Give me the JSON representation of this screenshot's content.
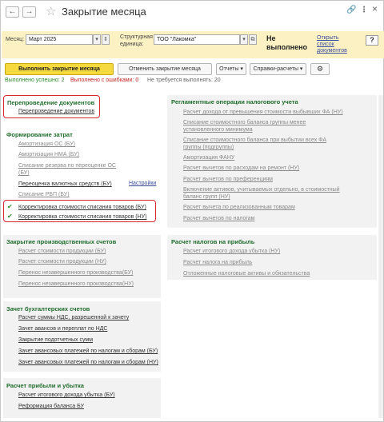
{
  "window": {
    "title": "Закрытие месяца",
    "back_arrow": "←",
    "forward_arrow": "→",
    "star": "☆",
    "link_icon": "🔗",
    "more_icon": "⋮",
    "close_icon": "×"
  },
  "filters": {
    "month_label": "Месяц:",
    "month_value": "Март 2025",
    "unit_label_1": "Структурная",
    "unit_label_2": "единица:",
    "unit_value": "ТОО \"Лакомка\"",
    "status_line1": "Не",
    "status_line2": "выполнено",
    "docs_link_1": "Открыть",
    "docs_link_2": "список",
    "docs_link_3": "документов",
    "help": "?"
  },
  "toolbar": {
    "run": "Выполнить закрытие месяца",
    "cancel": "Отменить закрытие месяца",
    "reports": "Отчеты ▾",
    "references": "Справки-расчеты ▾",
    "gear": "⚙"
  },
  "stats": {
    "success": "Выполнено успешно: 2",
    "errors": "Выполнено с ошибками: 0",
    "not_required": "Не требуется выполнять: 20"
  },
  "sections": {
    "repost": {
      "title": "Перепроведение документов",
      "items": [
        "Перепроведение документов"
      ]
    },
    "costs": {
      "title": "Формирование затрат",
      "items": [
        "Амортизация ОС (БУ)",
        "Амортизация НМА (БУ)",
        "Списание резерва по переоценке ОС (БУ)",
        "Переоценка валютных средств (БУ)",
        "Списание РБП (БУ)",
        "Корректировка стоимости списания товаров (БУ)",
        "Корректировка стоимости списания товаров (НУ)"
      ],
      "settings": "Настройки"
    },
    "tax_ops": {
      "title": "Регламентные операции налогового учета",
      "items": [
        "Расчет дохода от превышения стоимости выбывших ФА (НУ)",
        "Списание стоимостного баланса группы менее установленного минимума",
        "Списание стоимостного баланса при выбытии всех ФА группы (подгруппы)",
        "Амортизация ФАНУ",
        "Расчет вычетов по расходам на ремонт (НУ)",
        "Расчет вычетов по преференциям",
        "Включение активов, учитываемых отдельно, в стоимостный баланс групп (НУ)",
        "Расчет вычета по реализованным товарам",
        "Расчет вычетов по налогам"
      ]
    },
    "production": {
      "title": "Закрытие производственных счетов",
      "items": [
        "Расчет стоимости продукции (БУ)",
        "Расчет стоимости продукции (НУ)",
        "Перенос незавершенного производства(БУ)",
        "Перенос незавершенного производства(НУ)"
      ]
    },
    "income_tax": {
      "title": "Расчет налогов на прибыль",
      "items": [
        "Расчет итогового дохода убытка (НУ)",
        "Расчет налога на прибыль",
        "Отложенные налоговые активы и обязательства"
      ]
    },
    "accounting": {
      "title": "Зачет бухгалтерских счетов",
      "items": [
        "Расчет суммы НДС, разрешенной к зачету",
        "Зачет авансов и переплат по НДС",
        "Закрытие подотчетных сумм",
        "Зачет авансовых платежей по налогам и сборам (БУ)",
        "Зачет авансовых платежей по налогам и сборам (НУ)"
      ]
    },
    "profit": {
      "title": "Расчет прибыли и убытка",
      "items": [
        "Расчет итогового дохода убытка (БУ)",
        "Реформация баланса БУ"
      ]
    }
  },
  "colors": {
    "accent_green": "#1f6d2c",
    "link_gray": "#8a8a8a",
    "highlight_red": "#d7262c",
    "button_yellow": "#f6d93e",
    "filter_bar": "#fbf1c2"
  }
}
